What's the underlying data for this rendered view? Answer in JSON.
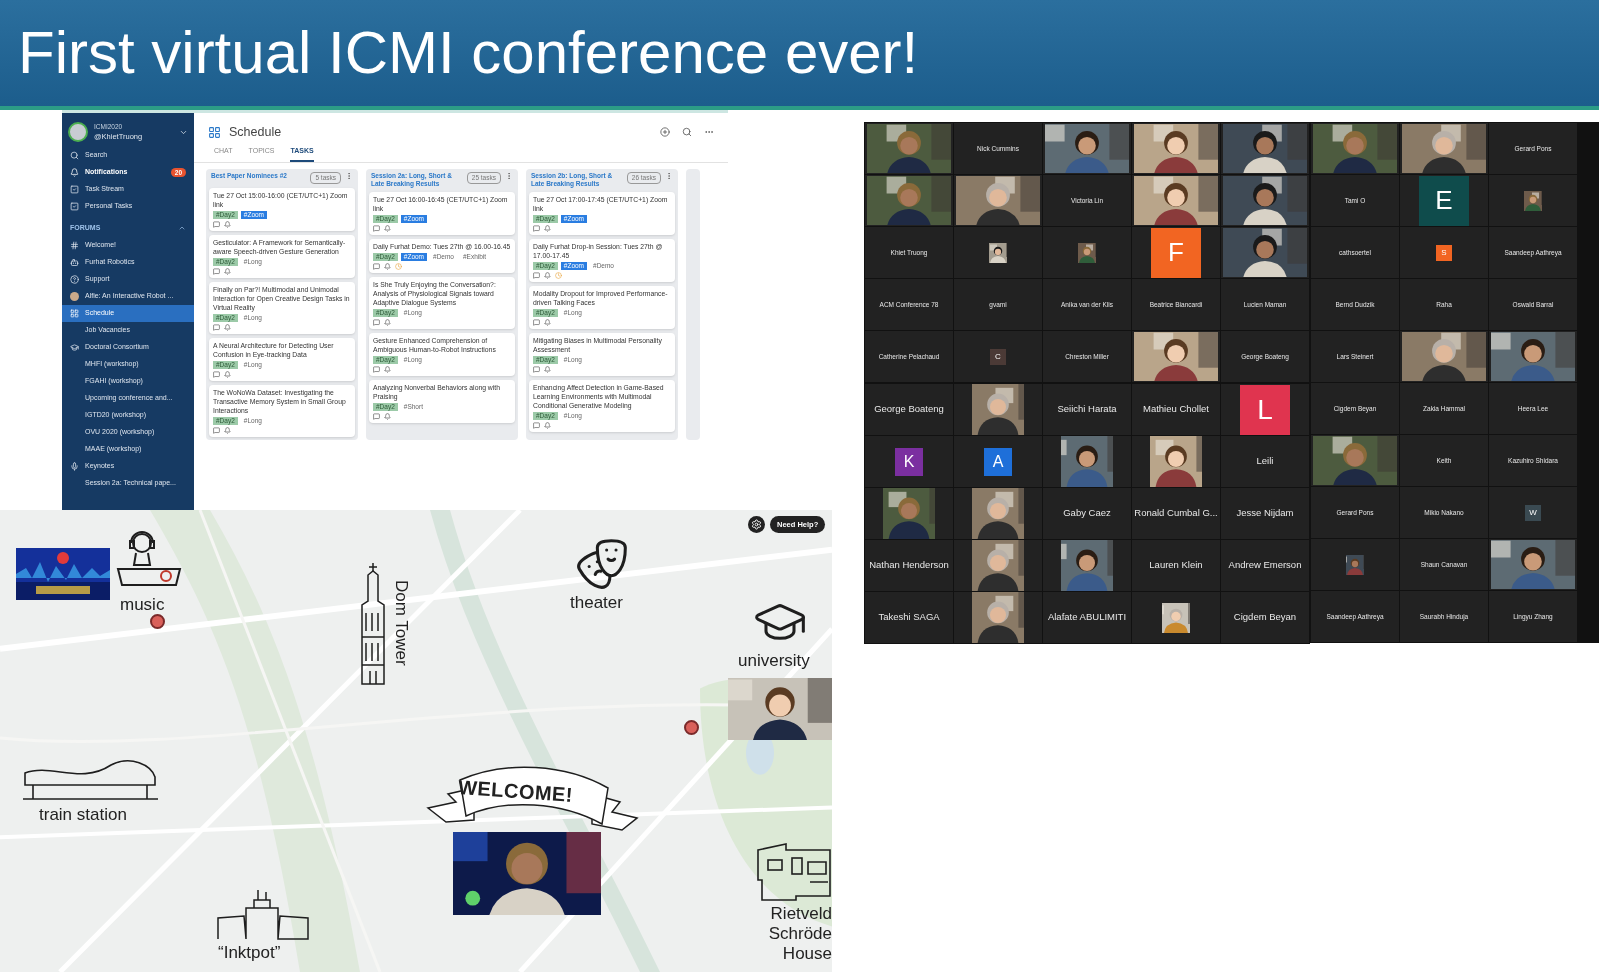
{
  "slide": {
    "title": "First virtual ICMI conference ever!"
  },
  "schedule": {
    "account": {
      "org": "ICMI2020",
      "handle": "@KhietTruong"
    },
    "nav": [
      {
        "label": "Search",
        "selected": false
      },
      {
        "label": "Notifications",
        "selected": false,
        "unread": true,
        "badge": "20"
      },
      {
        "label": "Task Stream",
        "selected": false
      },
      {
        "label": "Personal Tasks",
        "selected": false
      }
    ],
    "forums_heading": "FORUMS",
    "forums": [
      {
        "label": "Welcome!",
        "selected": false
      },
      {
        "label": "Furhat Robotics",
        "selected": false
      },
      {
        "label": "Support",
        "selected": false
      },
      {
        "label": "Alfie: An Interactive Robot ...",
        "selected": false
      },
      {
        "label": "Schedule",
        "selected": true
      },
      {
        "label": "Job Vacancies",
        "selected": false
      },
      {
        "label": "Doctoral Consortium",
        "selected": false
      },
      {
        "label": "MHFI (workshop)",
        "selected": false
      },
      {
        "label": "FGAHI (workshop)",
        "selected": false
      },
      {
        "label": "Upcoming conference and...",
        "selected": false
      },
      {
        "label": "IGTD20 (workshop)",
        "selected": false
      },
      {
        "label": "OVU 2020 (workshop)",
        "selected": false
      },
      {
        "label": "MAAE (workshop)",
        "selected": false
      },
      {
        "label": "Keynotes",
        "selected": false
      },
      {
        "label": "Session 2a: Technical pape...",
        "selected": false
      }
    ],
    "title": "Schedule",
    "tabs": [
      {
        "label": "CHAT",
        "selected": false
      },
      {
        "label": "TOPICS",
        "selected": false
      },
      {
        "label": "TASKS",
        "selected": true
      }
    ],
    "columns": [
      {
        "title": "Best Paper Nominees #2",
        "count": "5 tasks",
        "cards": [
          {
            "title": "Tue 27 Oct 15:00-16:00 (CET/UTC+1) Zoom link",
            "tags": [
              {
                "label": "#Day2",
                "kind": "day"
              },
              {
                "label": "#Zoom",
                "kind": "zoom"
              }
            ]
          },
          {
            "title": "Gesticulator: A Framework for Semantically-aware Speech-driven Gesture Generation",
            "tags": [
              {
                "label": "#Day2",
                "kind": "day"
              },
              {
                "label": "#Long",
                "kind": "plain"
              }
            ]
          },
          {
            "title": "Finally on Par?! Multimodal and Unimodal Interaction for Open Creative Design Tasks in Virtual Reality",
            "tags": [
              {
                "label": "#Day2",
                "kind": "day"
              },
              {
                "label": "#Long",
                "kind": "plain"
              }
            ]
          },
          {
            "title": "A Neural Architecture for Detecting User Confusion in Eye-tracking Data",
            "tags": [
              {
                "label": "#Day2",
                "kind": "day"
              },
              {
                "label": "#Long",
                "kind": "plain"
              }
            ]
          },
          {
            "title": "The WoNoWa Dataset: Investigating the Transactive Memory System in Small Group Interactions",
            "tags": [
              {
                "label": "#Day2",
                "kind": "day"
              },
              {
                "label": "#Long",
                "kind": "plain"
              }
            ]
          }
        ]
      },
      {
        "title": "Session 2a: Long, Short & Late Breaking Results",
        "count": "25 tasks",
        "cards": [
          {
            "title": "Tue 27 Oct 16:00-16:45 (CET/UTC+1) Zoom link",
            "tags": [
              {
                "label": "#Day2",
                "kind": "day"
              },
              {
                "label": "#Zoom",
                "kind": "zoom"
              }
            ]
          },
          {
            "title": "Daily Furhat Demo: Tues 27th @ 16.00-16.45",
            "reminder": true,
            "tags": [
              {
                "label": "#Day2",
                "kind": "day"
              },
              {
                "label": "#Zoom",
                "kind": "zoom"
              },
              {
                "label": "#Demo",
                "kind": "plain"
              },
              {
                "label": "#Exhibit",
                "kind": "plain"
              }
            ]
          },
          {
            "title": "Is She Truly Enjoying the Conversation?: Analysis of Physiological Signals toward Adaptive Dialogue Systems",
            "tags": [
              {
                "label": "#Day2",
                "kind": "day"
              },
              {
                "label": "#Long",
                "kind": "plain"
              }
            ]
          },
          {
            "title": "Gesture Enhanced Comprehension of Ambiguous Human-to-Robot Instructions",
            "tags": [
              {
                "label": "#Day2",
                "kind": "day"
              },
              {
                "label": "#Long",
                "kind": "plain"
              }
            ]
          },
          {
            "title": "Analyzing Nonverbal Behaviors along with Praising",
            "tags": [
              {
                "label": "#Day2",
                "kind": "day"
              },
              {
                "label": "#Short",
                "kind": "plain"
              }
            ]
          }
        ]
      },
      {
        "title": "Session 2b: Long, Short & Late Breaking Results",
        "count": "26 tasks",
        "cards": [
          {
            "title": "Tue 27 Oct 17:00-17:45 (CET/UTC+1) Zoom link",
            "tags": [
              {
                "label": "#Day2",
                "kind": "day"
              },
              {
                "label": "#Zoom",
                "kind": "zoom"
              }
            ]
          },
          {
            "title": "Daily Furhat Drop-in Session: Tues 27th @ 17.00-17.45",
            "reminder": true,
            "tags": [
              {
                "label": "#Day2",
                "kind": "day"
              },
              {
                "label": "#Zoom",
                "kind": "zoom"
              },
              {
                "label": "#Demo",
                "kind": "plain"
              }
            ]
          },
          {
            "title": "Modality Dropout for Improved Performance-driven Talking Faces",
            "tags": [
              {
                "label": "#Day2",
                "kind": "day"
              },
              {
                "label": "#Long",
                "kind": "plain"
              }
            ]
          },
          {
            "title": "Mitigating Biases in Multimodal Personality Assessment",
            "tags": [
              {
                "label": "#Day2",
                "kind": "day"
              },
              {
                "label": "#Long",
                "kind": "plain"
              }
            ]
          },
          {
            "title": "Enhancing Affect Detection in Game-Based Learning Environments with Multimodal Conditional Generative Modeling",
            "tags": [
              {
                "label": "#Day2",
                "kind": "day"
              },
              {
                "label": "#Long",
                "kind": "plain"
              }
            ]
          }
        ]
      }
    ]
  },
  "zoom": {
    "galleries": [
      {
        "kind": "compact",
        "rows": [
          [
            {
              "kind": "picture"
            },
            {
              "kind": "name",
              "name": "Nick Cummins"
            },
            {
              "kind": "picture"
            },
            {
              "kind": "picture"
            },
            {
              "kind": "picture"
            }
          ],
          [
            {
              "kind": "picture"
            },
            {
              "kind": "picture"
            },
            {
              "kind": "name",
              "name": "Victoria Lin"
            },
            {
              "kind": "picture"
            },
            {
              "kind": "picture"
            }
          ],
          [
            {
              "kind": "name",
              "name": "Khiet Truong"
            },
            {
              "kind": "thumb"
            },
            {
              "kind": "thumb"
            },
            {
              "kind": "letter",
              "letter": "F",
              "color": "#f26522"
            },
            {
              "kind": "picture"
            }
          ],
          [
            {
              "kind": "name",
              "name": "ACM Conference 78"
            },
            {
              "kind": "name",
              "name": "gvami"
            },
            {
              "kind": "name",
              "name": "Anika van der Klis"
            },
            {
              "kind": "name",
              "name": "Beatrice Biancardi"
            },
            {
              "kind": "name",
              "name": "Lucien Maman"
            }
          ],
          [
            {
              "kind": "name",
              "name": "Catherine Pelachaud"
            },
            {
              "kind": "chip",
              "letter": "C",
              "color": "#4b3a36"
            },
            {
              "kind": "name",
              "name": "Chreston Miller"
            },
            {
              "kind": "picture"
            },
            {
              "kind": "name",
              "name": "George Boateng"
            }
          ]
        ]
      },
      {
        "kind": "large",
        "rows": [
          [
            {
              "kind": "name",
              "name": "George Boateng"
            },
            {
              "kind": "picture"
            },
            {
              "kind": "name",
              "name": "Seiichi Harata"
            },
            {
              "kind": "name",
              "name": "Mathieu Chollet"
            },
            {
              "kind": "letter",
              "letter": "L",
              "color": "#e0344f"
            }
          ],
          [
            {
              "kind": "chip",
              "letter": "K",
              "color": "#7b2fa0"
            },
            {
              "kind": "chip",
              "letter": "A",
              "color": "#1e6fd9"
            },
            {
              "kind": "picture"
            },
            {
              "kind": "picture"
            },
            {
              "kind": "name",
              "name": "Leili"
            }
          ],
          [
            {
              "kind": "picture"
            },
            {
              "kind": "picture"
            },
            {
              "kind": "name",
              "name": "Gaby Caez"
            },
            {
              "kind": "name",
              "name": "Ronald Cumbal G..."
            },
            {
              "kind": "name",
              "name": "Jesse Nijdam"
            }
          ],
          [
            {
              "kind": "name",
              "name": "Nathan Henderson"
            },
            {
              "kind": "picture"
            },
            {
              "kind": "picture"
            },
            {
              "kind": "name",
              "name": "Lauren Klein"
            },
            {
              "kind": "name",
              "name": "Andrew Emerson"
            }
          ],
          [
            {
              "kind": "name",
              "name": "Takeshi SAGA"
            },
            {
              "kind": "picture"
            },
            {
              "kind": "name",
              "name": "Alafate ABULIMITI"
            },
            {
              "kind": "thumb"
            },
            {
              "kind": "name",
              "name": "Cigdem Beyan"
            }
          ]
        ]
      },
      {
        "kind": "compact",
        "rows": [
          [
            {
              "kind": "picture"
            },
            {
              "kind": "picture"
            },
            {
              "kind": "name",
              "name": "Gerard Pons"
            }
          ],
          [
            {
              "kind": "name",
              "name": "Tami O"
            },
            {
              "kind": "letter",
              "letter": "E",
              "color": "#0f4c4c"
            },
            {
              "kind": "thumb"
            }
          ],
          [
            {
              "kind": "name",
              "name": "cathsoertel"
            },
            {
              "kind": "chip",
              "letter": "S",
              "color": "#f26522"
            },
            {
              "kind": "name",
              "name": "Saandeep Aathreya"
            }
          ],
          [
            {
              "kind": "name",
              "name": "Bernd Dudzik"
            },
            {
              "kind": "name",
              "name": "Raha"
            },
            {
              "kind": "name",
              "name": "Oswald Barral"
            }
          ],
          [
            {
              "kind": "name",
              "name": "Lars Steinert"
            },
            {
              "kind": "picture"
            },
            {
              "kind": "picture"
            }
          ],
          [
            {
              "kind": "name",
              "name": "Cigdem Beyan"
            },
            {
              "kind": "name",
              "name": "Zakia Hammal"
            },
            {
              "kind": "name",
              "name": "Heera Lee"
            }
          ],
          [
            {
              "kind": "picture"
            },
            {
              "kind": "name",
              "name": "Keith"
            },
            {
              "kind": "name",
              "name": "Kazuhiro Shidara"
            }
          ],
          [
            {
              "kind": "name",
              "name": "Gerard Pons"
            },
            {
              "kind": "name",
              "name": "Mikio Nakano"
            },
            {
              "kind": "chip",
              "letter": "W",
              "color": "#3a4a52"
            }
          ],
          [
            {
              "kind": "thumb"
            },
            {
              "kind": "name",
              "name": "Shaun Canavan"
            },
            {
              "kind": "picture"
            }
          ],
          [
            {
              "kind": "name",
              "name": "Saandeep Aathreya"
            },
            {
              "kind": "name",
              "name": "Saurabh Hinduja"
            },
            {
              "kind": "name",
              "name": "Lingyu Zhang"
            }
          ]
        ]
      }
    ]
  },
  "map": {
    "help_button": "Need Help?",
    "places": [
      {
        "kind": "music",
        "label": "music"
      },
      {
        "kind": "tower",
        "label": "Dom Tower"
      },
      {
        "kind": "theater",
        "label": "theater"
      },
      {
        "kind": "university",
        "label": "university"
      },
      {
        "kind": "station",
        "label": "train station"
      },
      {
        "kind": "welcome",
        "label": "WELCOME!"
      },
      {
        "kind": "inktpot",
        "label": "“Inktpot”"
      },
      {
        "kind": "house",
        "lines": [
          "Rietveld",
          "Schröde",
          "House"
        ]
      }
    ]
  }
}
